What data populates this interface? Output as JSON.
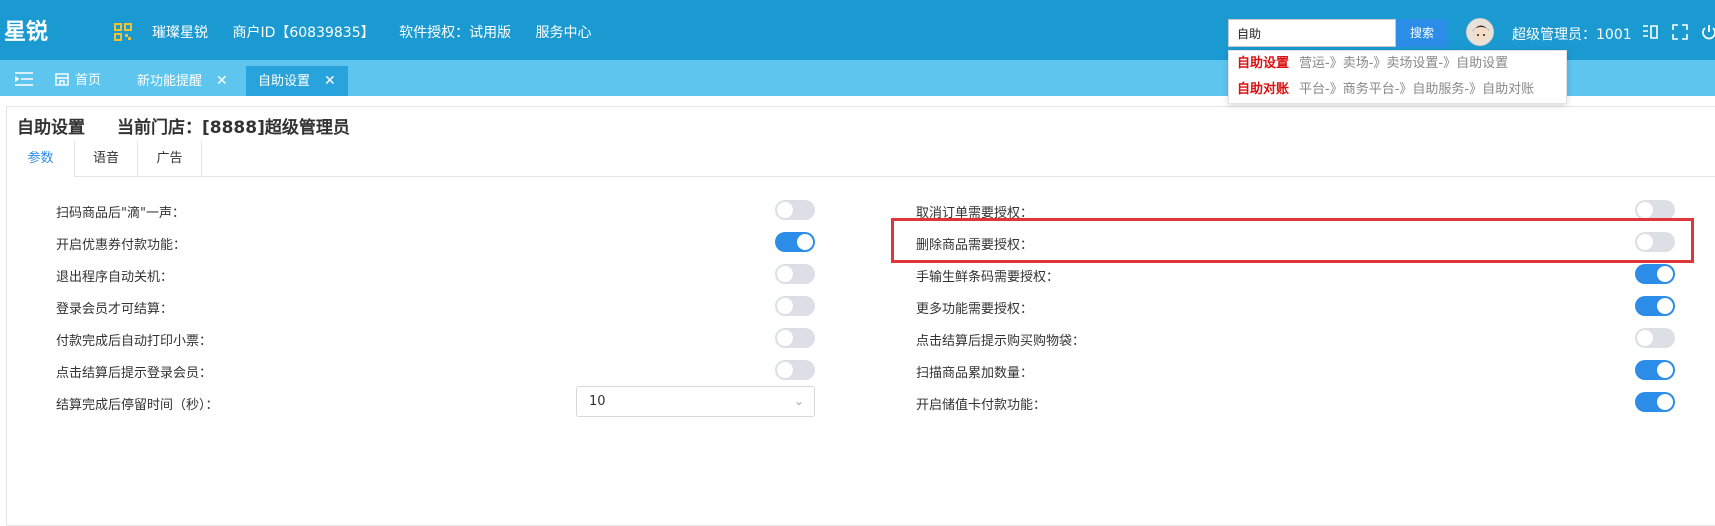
{
  "header": {
    "brand": "星锐",
    "qr_icon": "qr-code-icon",
    "nav": [
      "璀璨星锐",
      "商户ID【60839835】",
      "软件授权：试用版",
      "服务中心"
    ],
    "search_value": "自助",
    "search_button": "搜索",
    "admin": "超级管理员：1001",
    "right_icons": [
      "layout-icon",
      "fullscreen-icon",
      "power-icon"
    ]
  },
  "tabs": {
    "menu_icon": "menu-toggle-icon",
    "home_icon": "home-icon",
    "home": "首页",
    "new_feature": "新功能提醒",
    "self_service": "自助设置",
    "close_glyph": "✕"
  },
  "dropdown": [
    {
      "keyword": "自助设置",
      "path": "营运-》卖场-》卖场设置-》自助设置"
    },
    {
      "keyword": "自助对账",
      "path": "平台-》商务平台-》自助服务-》自助对账"
    }
  ],
  "panel": {
    "title": "自助设置",
    "store": "当前门店：[8888]超级管理员",
    "subtabs": [
      "参数",
      "语音",
      "广告"
    ]
  },
  "settings_left": [
    {
      "label": "扫码商品后\"滴\"一声：",
      "on": false
    },
    {
      "label": "开启优惠券付款功能：",
      "on": true
    },
    {
      "label": "退出程序自动关机：",
      "on": false
    },
    {
      "label": "登录会员才可结算：",
      "on": false
    },
    {
      "label": "付款完成后自动打印小票：",
      "on": false
    },
    {
      "label": "点击结算后提示登录会员：",
      "on": false
    }
  ],
  "stay_time": {
    "label": "结算完成后停留时间（秒）：",
    "value": "10"
  },
  "settings_right": [
    {
      "label": "取消订单需要授权：",
      "on": false
    },
    {
      "label": "删除商品需要授权：",
      "on": false
    },
    {
      "label": "手输生鲜条码需要授权：",
      "on": true
    },
    {
      "label": "更多功能需要授权：",
      "on": true
    },
    {
      "label": "点击结算后提示购买购物袋：",
      "on": false
    },
    {
      "label": "扫描商品累加数量：",
      "on": true
    },
    {
      "label": "开启储值卡付款功能：",
      "on": true
    }
  ],
  "colors": {
    "header": "#1b9ad2",
    "tabbar": "#5ec5ef",
    "accent": "#2c8de8",
    "highlight": "#e0353a"
  }
}
